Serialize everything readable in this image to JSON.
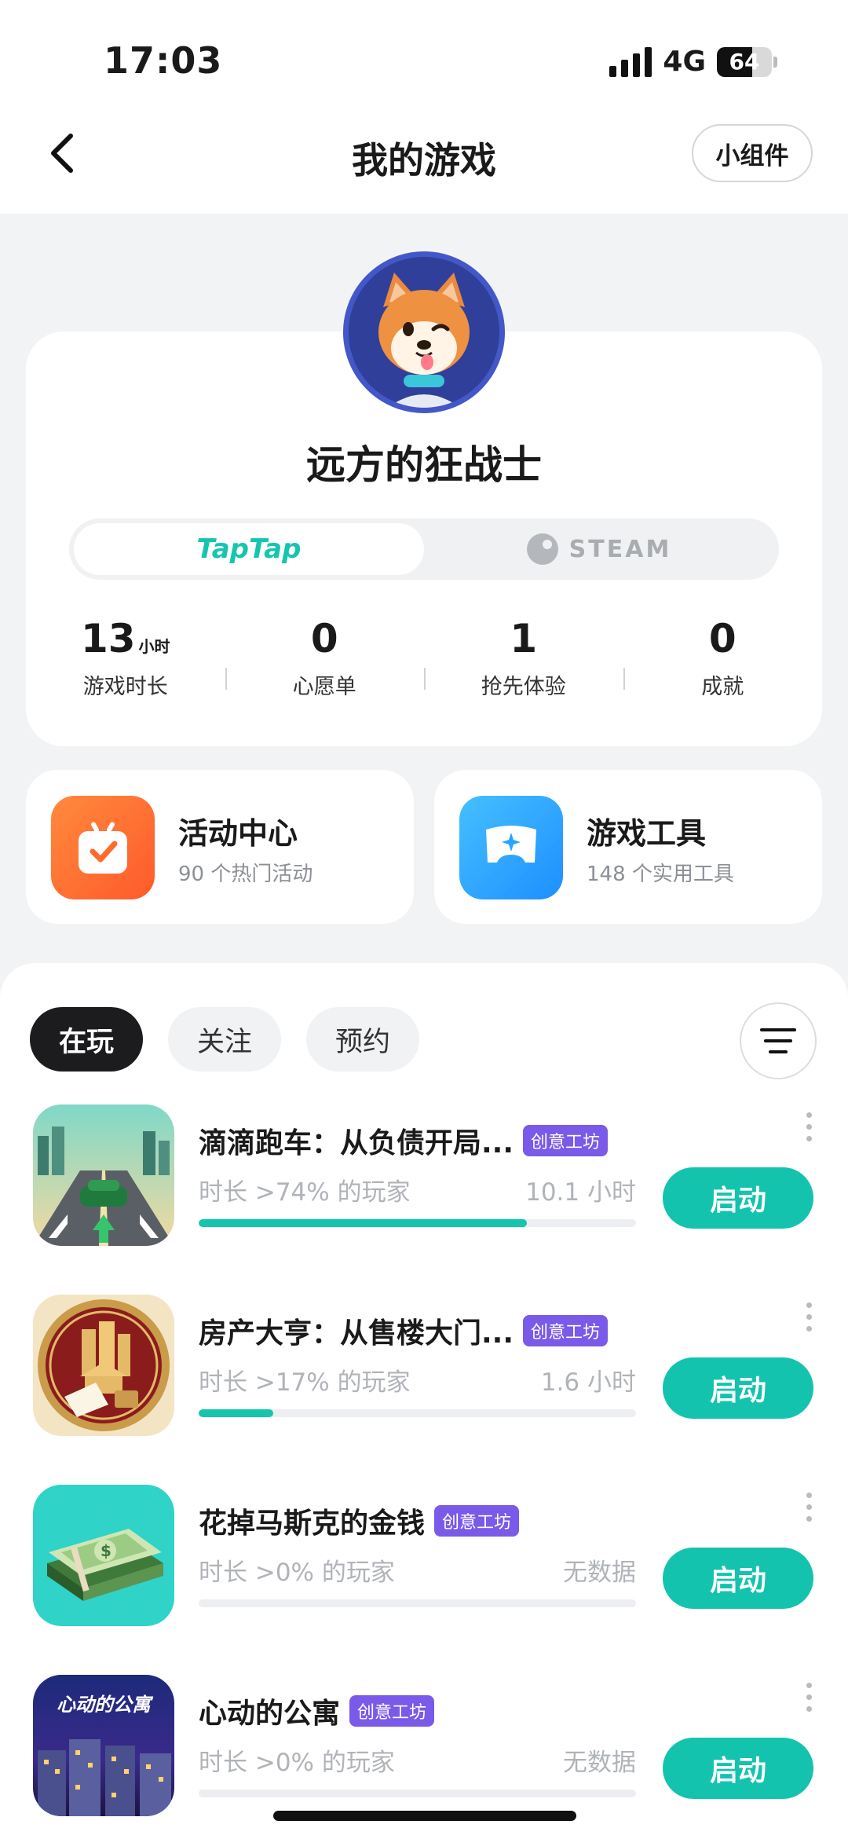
{
  "status_bar": {
    "time": "17:03",
    "network": "4G",
    "battery": "64",
    "battery_level_percent": 64
  },
  "header": {
    "title": "我的游戏",
    "widget_label": "小组件"
  },
  "profile": {
    "username": "远方的狂战士",
    "platform_tabs": {
      "taptap": "TapTap",
      "steam": "STEAM",
      "active": "taptap"
    },
    "stats": [
      {
        "value": "13",
        "unit": "小时",
        "label": "游戏时长"
      },
      {
        "value": "0",
        "unit": "",
        "label": "心愿单"
      },
      {
        "value": "1",
        "unit": "",
        "label": "抢先体验"
      },
      {
        "value": "0",
        "unit": "",
        "label": "成就"
      }
    ]
  },
  "features": [
    {
      "title": "活动中心",
      "subtitle": "90 个热门活动",
      "icon": "calendar-check-icon",
      "color": "#ff6b2c"
    },
    {
      "title": "游戏工具",
      "subtitle": "148 个实用工具",
      "icon": "gamepad-icon",
      "color": "#2aa4ff"
    }
  ],
  "filter_tabs": [
    {
      "label": "在玩",
      "active": true
    },
    {
      "label": "关注",
      "active": false
    },
    {
      "label": "预约",
      "active": false
    }
  ],
  "games": [
    {
      "title": "滴滴跑车：从负债开局...",
      "badge": "创意工坊",
      "rank": "时长 >74% 的玩家",
      "hours": "10.1 小时",
      "progress": 0.75,
      "launch": "启动"
    },
    {
      "title": "房产大亨：从售楼大门...",
      "badge": "创意工坊",
      "rank": "时长 >17% 的玩家",
      "hours": "1.6 小时",
      "progress": 0.17,
      "launch": "启动"
    },
    {
      "title": "花掉马斯克的金钱",
      "badge": "创意工坊",
      "rank": "时长 >0% 的玩家",
      "hours": "无数据",
      "progress": 0,
      "launch": "启动"
    },
    {
      "title": "心动的公寓",
      "badge": "创意工坊",
      "rank": "时长 >0% 的玩家",
      "hours": "无数据",
      "progress": 0,
      "launch": "启动",
      "icon_text": "心动的公寓"
    }
  ],
  "colors": {
    "accent": "#14c3ad",
    "badge": "#7a5ae8"
  }
}
